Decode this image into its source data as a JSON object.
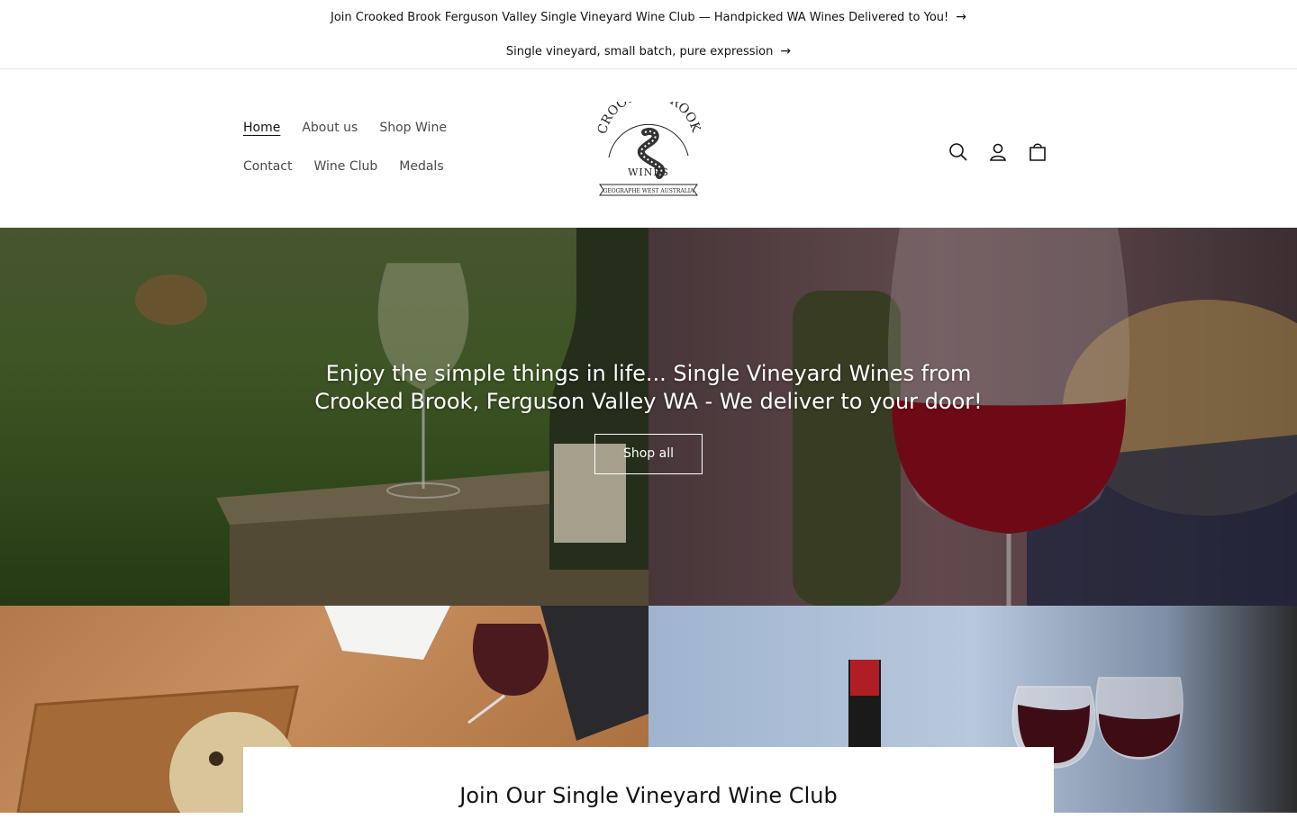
{
  "announcements": [
    {
      "text": "Join Crooked Brook Ferguson Valley Single Vineyard Wine Club — Handpicked WA Wines Delivered to You!"
    },
    {
      "text": "Single vineyard, small batch, pure expression"
    }
  ],
  "nav": {
    "items": [
      {
        "label": "Home"
      },
      {
        "label": "About us"
      },
      {
        "label": "Shop Wine"
      },
      {
        "label": "Contact"
      },
      {
        "label": "Wine Club"
      },
      {
        "label": "Medals"
      }
    ]
  },
  "logo": {
    "name": "CROOKED BROOK",
    "sub": "WINES",
    "ribbon": "GEOGRAPHE WEST AUSTRALIA"
  },
  "header_icons": {
    "search": "search-icon",
    "account": "account-icon",
    "cart": "cart-icon"
  },
  "hero": {
    "title": "Enjoy the simple things in life... Single Vineyard Wines from Crooked Brook, Ferguson Valley WA - We deliver to your door!",
    "button": "Shop all"
  },
  "club": {
    "title": "Join Our Single Vineyard Wine Club"
  },
  "colors": {
    "text": "#121212",
    "nav": "#4a4a4a",
    "divider": "#e6e6e6"
  }
}
